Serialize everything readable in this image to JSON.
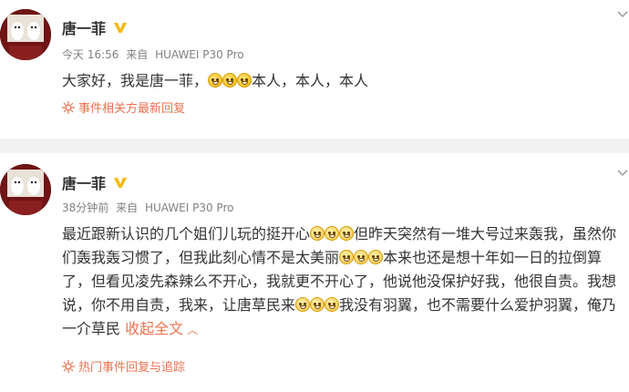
{
  "posts": [
    {
      "author": "唐一菲",
      "time": "今天 16:56",
      "source_prefix": "来自",
      "device": "HUAWEI P30 Pro",
      "text_before": "大家好，我是唐一菲，",
      "text_after": "本人，本人，本人",
      "event_link": "事件相关方最新回复"
    },
    {
      "author": "唐一菲",
      "time": "38分钟前",
      "source_prefix": "来自",
      "device": "HUAWEI P30 Pro",
      "seg1": "最近跟新认识的几个姐们儿玩的挺开心",
      "seg2": "但昨天突然有一堆大号过来轰我，虽然你们轰我轰习惯了，但我此刻心情不是太美丽",
      "seg3": "本来也还是想十年如一日的拉倒算了，但看见凌先森辣么不开心，我就更不开心了，他说他没保护好我，他很自责。我想说，你不用自责，我来，让唐草民来",
      "seg4": "我没有羽翼，也不需要什么爱护羽翼，俺乃一介草民",
      "collapse_link": "收起全文",
      "event_link": "热门事件回复与追踪"
    }
  ],
  "colors": {
    "link": "#eb7350",
    "meta": "#808080",
    "text": "#333333",
    "badge": "#f6b900"
  },
  "icons": {
    "verified": "verified-v-badge-icon",
    "event": "hot-event-icon",
    "menu": "chevron-down-icon",
    "collapse": "chevron-up-icon",
    "emoji_weep": "crying-face-emoji",
    "emoji_laugh": "grinning-face-emoji"
  }
}
